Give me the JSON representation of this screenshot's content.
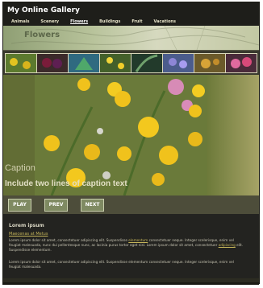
{
  "site": {
    "title": "My Online Gallery"
  },
  "nav": {
    "items": [
      {
        "label": "Animals"
      },
      {
        "label": "Scenery"
      },
      {
        "label": "Flowers"
      },
      {
        "label": "Buildings"
      },
      {
        "label": "Fruit"
      },
      {
        "label": "Vacations"
      }
    ]
  },
  "section": {
    "title": "Flowers"
  },
  "slide": {
    "caption_title": "Caption",
    "caption_text": "Include two lines of caption text"
  },
  "controls": {
    "play": "PLAY",
    "prev": "PREV",
    "next": "NEXT"
  },
  "content": {
    "heading": "Lorem ipsum",
    "link": "Maecenas at Metus",
    "para1_a": "Lorem ipsum dolor sit amet, consectetuer adipiscing elit. Suspendisse ",
    "para1_hl1": "elementum",
    "para1_b": " consectetuer neque. Integer scelerisque, enim vel",
    "para1_c": "feugiat malesuada, nunc dui pellentesque nunc, ac lacinia purus tortor eget nisl. Lorem ipsum dolor sit amet, consectetuer ",
    "para1_hl2": "adipiscing",
    "para1_d": " elit.",
    "para1_e": "Suspendisse elementum.",
    "para2_a": "Lorem ipsum dolor sit amet, consectetuer adipiscing elit. Suspendisse elementum consectetuer neque. Integer scelerisque, enim vel",
    "para2_b": "feugiat malesuada."
  }
}
